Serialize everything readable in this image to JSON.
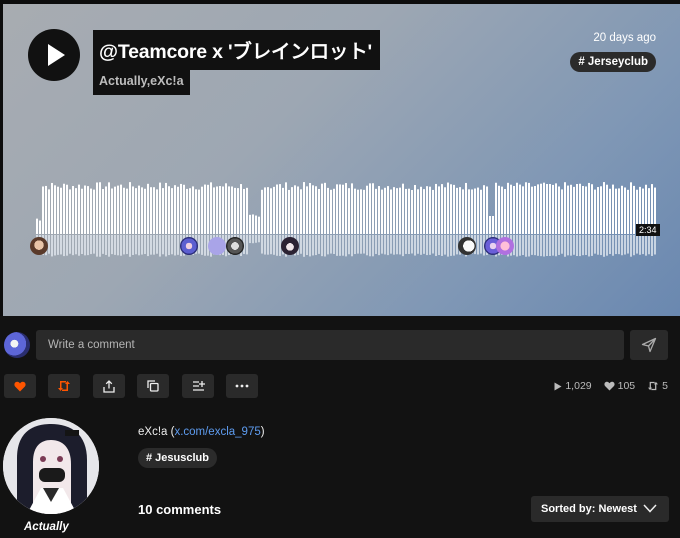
{
  "track": {
    "title": "@Teamcore x 'ブレインロット'",
    "artist": "Actually,eXc!a",
    "time_ago": "20 days ago",
    "genre_tag": "# Jerseyclub",
    "duration": "2:34"
  },
  "comment_box": {
    "placeholder": "Write a comment"
  },
  "stats": {
    "plays": "1,029",
    "likes": "105",
    "reposts": "5"
  },
  "uploader": {
    "name": "Actually"
  },
  "description": {
    "prefix": "eXc!a (",
    "link_text": "x.com/excla_975",
    "suffix": ")",
    "tag": "# Jesusclub"
  },
  "comments": {
    "count_label": "10 comments",
    "sort_label": "Sorted by: Newest"
  },
  "colors": {
    "accent": "#ff5500",
    "link": "#5e9cf0",
    "surface": "#2a2a2a"
  },
  "icons": [
    "play-icon",
    "send-icon",
    "heart-icon",
    "repost-icon",
    "share-icon",
    "copy-icon",
    "add-to-playlist-icon",
    "more-icon",
    "chevron-down-icon"
  ]
}
